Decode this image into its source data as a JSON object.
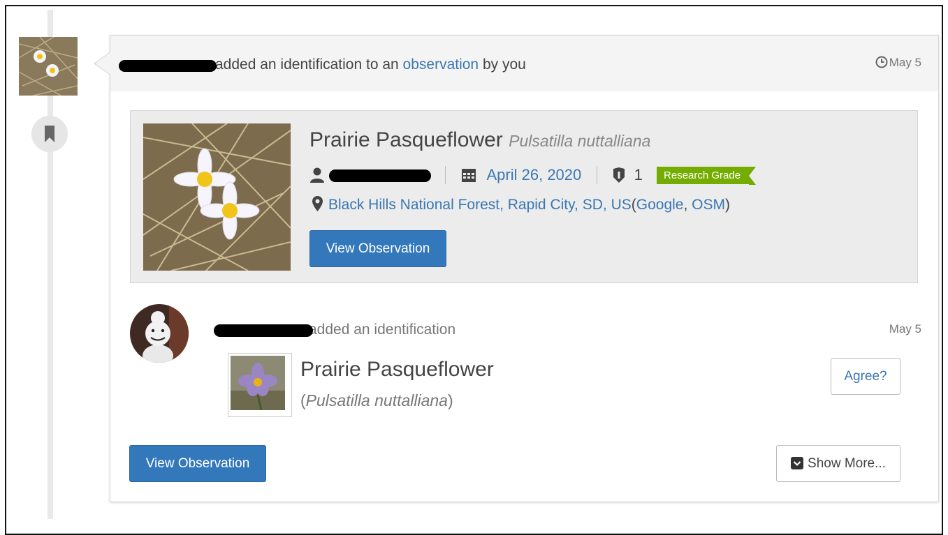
{
  "notification": {
    "user_redacted": "",
    "text_before": "added an identification to an ",
    "link": "observation",
    "text_after": " by you",
    "time": "May 5"
  },
  "observation": {
    "common_name": "Prairie Pasqueflower",
    "scientific_name": "Pulsatilla nuttalliana",
    "observer_redacted": "",
    "date": "April 26, 2020",
    "id_count": "1",
    "quality_badge": "Research Grade",
    "location": "Black Hills National Forest, Rapid City, SD, US",
    "map_links": {
      "open": "(",
      "google": "Google",
      "comma": ", ",
      "osm": "OSM",
      "close": ")"
    },
    "view_button": "View Observation"
  },
  "identification": {
    "user_redacted": "",
    "action": "added an identification",
    "time": "May 5",
    "common_name": "Prairie Pasqueflower",
    "sci_open": "(",
    "scientific_name": "Pulsatilla nuttalliana",
    "sci_close": ")",
    "agree_button": "Agree?"
  },
  "footer": {
    "view_button": "View Observation",
    "show_more_button": "Show More..."
  },
  "colors": {
    "link": "#3a77b4",
    "primary_button": "#3478bc",
    "research_grade": "#74ac00",
    "header_bg": "#f4f4f4",
    "obs_box_bg": "#ececec"
  },
  "icons": [
    "bookmark-icon",
    "clock-icon",
    "user-icon",
    "calendar-icon",
    "identification-shield-icon",
    "map-marker-icon",
    "chevron-square-down-icon"
  ]
}
